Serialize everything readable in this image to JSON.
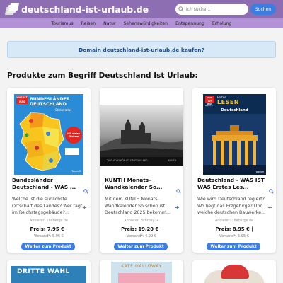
{
  "header": {
    "site_title": "deutschland-ist-urlaub.de",
    "search_placeholder": "Ich suche...",
    "search_button": "Suchen",
    "logo_icon": "stacked-pages-logo-icon",
    "search_icon": "magnifier-icon"
  },
  "nav": {
    "items": [
      "Tourismus",
      "Reisen",
      "Natur",
      "Sehenswürdigkeiten",
      "Entspannung",
      "Erholung"
    ]
  },
  "banner": {
    "text": "Domain deutschland-ist-urlaub.de kaufen?"
  },
  "section": {
    "title": "Produkte zum Begriff Deutschland Ist Urlaub:"
  },
  "colors": {
    "header_bg": "#8e6eb2",
    "nav_bg": "#b391d6",
    "button": "#3b7de0",
    "banner_bg": "#d7e8f7"
  },
  "products": [
    {
      "title": "Bundesländer Deutschland - WAS ...",
      "description": "Welche ist die südlichste Ortschaft des Landes? Wer tagt im Reichstagsgebäude?...",
      "seller": "Anbieter: 18aberge.de",
      "price": "Preis: 7.95 € |",
      "shipping": "Versand*: 5.95 €",
      "button": "Weiter zum Produkt",
      "cover_texts": [
        "WAS IST WAS",
        "BUNDESLÄNDER",
        "DEUTSCHLAND",
        "Stickeratlas",
        "Mit vielen Stickern",
        "Tessloff"
      ]
    },
    {
      "title": "KUNTH Monats-Wandkalender So...",
      "description": "Mit dem KUNTH Monats-Wandkalender So schön ist Deutschland 2025 bekomm...",
      "seller": "Anbieter: 3chrbay24",
      "price": "Preis: 19.20 € |",
      "shipping": "Versand*: 4.99 €",
      "button": "Weiter zum Produkt",
      "cover_texts": [
        "2025 SO SCHÖN IST DEUTSCHLAND",
        "KUNTH"
      ]
    },
    {
      "title": "Deutschland - WAS IST WAS Erstes Les...",
      "description": "Wie wird Deutschland regiert? Wo liegt das Erzgebirge? Und welche deutschen Bauwerke...",
      "seller": "Anbieter: 18aberge.de",
      "price": "Preis: 8.95 € |",
      "shipping": "Versand*: 5.95 €",
      "button": "Weiter zum Produkt",
      "cover_texts": [
        "WAS IST WAS",
        "Erstes",
        "LESEN",
        "Band 3",
        "Deutschland",
        "Tessloff"
      ]
    }
  ],
  "second_row": [
    {
      "cover_text": "DRITTE WAHL"
    },
    {
      "cover_text": "KATE GALLOWAY"
    },
    {
      "cover_text": ""
    }
  ]
}
